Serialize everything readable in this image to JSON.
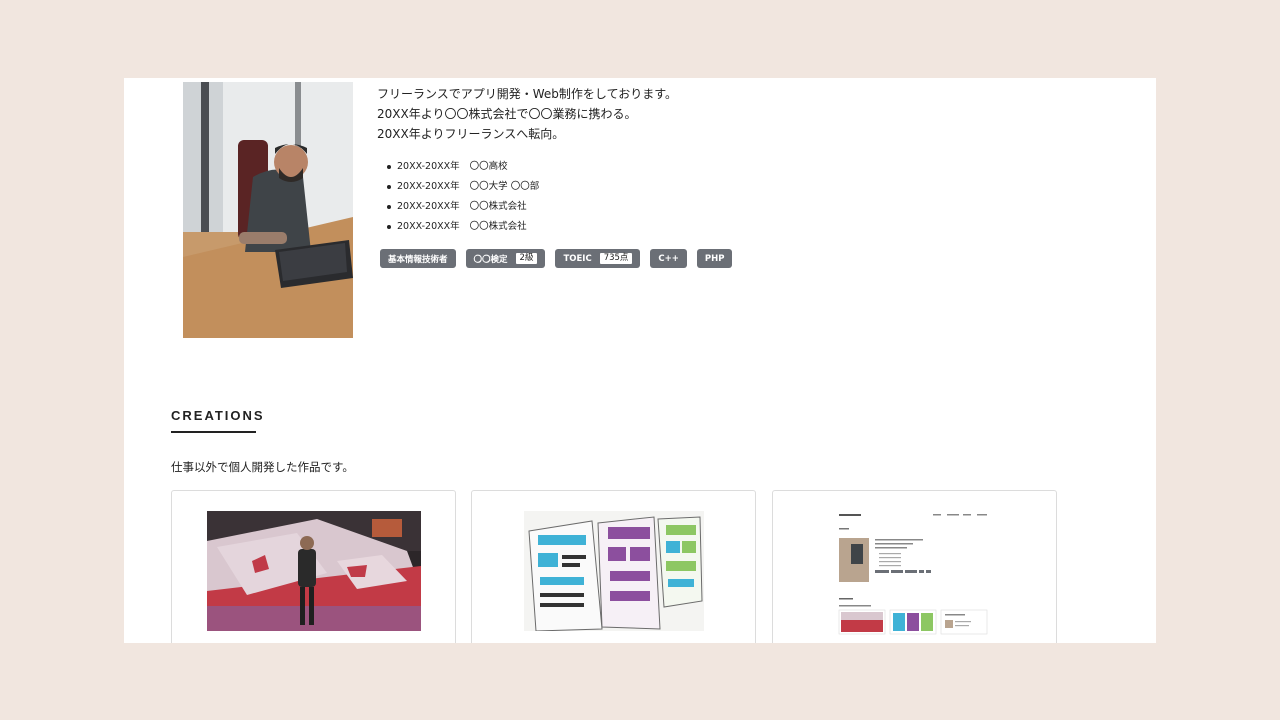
{
  "profile": {
    "bio": [
      "フリーランスでアプリ開発・Web制作をしております。",
      "20XX年より〇〇株式会社で〇〇業務に携わる。",
      "20XX年よりフリーランスへ転向。"
    ],
    "history": [
      {
        "period": "20XX-20XX年",
        "place": "〇〇高校"
      },
      {
        "period": "20XX-20XX年",
        "place": "〇〇大学 〇〇部"
      },
      {
        "period": "20XX-20XX年",
        "place": "〇〇株式会社"
      },
      {
        "period": "20XX-20XX年",
        "place": "〇〇株式会社"
      }
    ],
    "skills": [
      {
        "label": "基本情報技術者"
      },
      {
        "label": "〇〇検定",
        "sub": "2級"
      },
      {
        "label": "TOEIC",
        "sub": "735点"
      },
      {
        "label": "C++"
      },
      {
        "label": "PHP"
      }
    ]
  },
  "creations": {
    "title": "CREATIONS",
    "description": "仕事以外で個人開発した作品です。"
  },
  "colors": {
    "page_background": "#f1e6df",
    "tag_background": "#6b6f76"
  }
}
